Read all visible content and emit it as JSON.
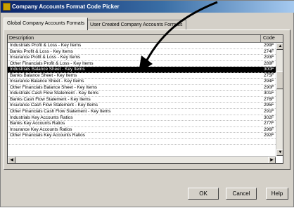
{
  "window": {
    "title": "Company Accounts Format Code Picker",
    "icon": "app-icon"
  },
  "tabs": [
    {
      "label": "Global Company Accounts Formats",
      "active": true
    },
    {
      "label": "User Created Company Accounts Formats",
      "active": false
    }
  ],
  "list": {
    "columns": {
      "description": "Description",
      "code": "Code"
    },
    "rows": [
      {
        "description": "Industrials Profit & Loss - Key Items",
        "code": "299F"
      },
      {
        "description": "Banks Profit & Loss - Key Items",
        "code": "274F"
      },
      {
        "description": "Insurance Profit & Loss - Key Items",
        "code": "293F"
      },
      {
        "description": "Other Financials Profit & Loss - Key Items",
        "code": "289F"
      },
      {
        "description": "Industrials Balance Sheet - Key Items",
        "code": "300F",
        "selected": true
      },
      {
        "description": "Banks Balance Sheet - Key Items",
        "code": "275F"
      },
      {
        "description": "Insurance Balance Sheet - Key Items",
        "code": "294F"
      },
      {
        "description": "Other Financials Balance Sheet - Key Items",
        "code": "290F"
      },
      {
        "description": "Industrials Cash Flow Statement - Key Items",
        "code": "301F"
      },
      {
        "description": "Banks Cash Flow Statement - Key Items",
        "code": "276F"
      },
      {
        "description": "Insurance Cash Flow Statement - Key Items",
        "code": "295F"
      },
      {
        "description": "Other Financials Cash Flow Statement - Key Items",
        "code": "291F"
      },
      {
        "description": "Industrials Key Accounts Ratios",
        "code": "302F"
      },
      {
        "description": "Banks Key Accounts Ratios",
        "code": "277F"
      },
      {
        "description": "Insurance Key Accounts Ratios",
        "code": "296F"
      },
      {
        "description": "Other Financials Key Accounts Ratios",
        "code": "292F"
      },
      {
        "description": "",
        "code": ""
      }
    ]
  },
  "buttons": {
    "ok": "OK",
    "cancel": "Cancel",
    "help": "Help"
  },
  "colors": {
    "selection": "#000000",
    "title_start": "#0a246a",
    "title_end": "#a6caf0",
    "annotation_arrow": "#000000"
  }
}
